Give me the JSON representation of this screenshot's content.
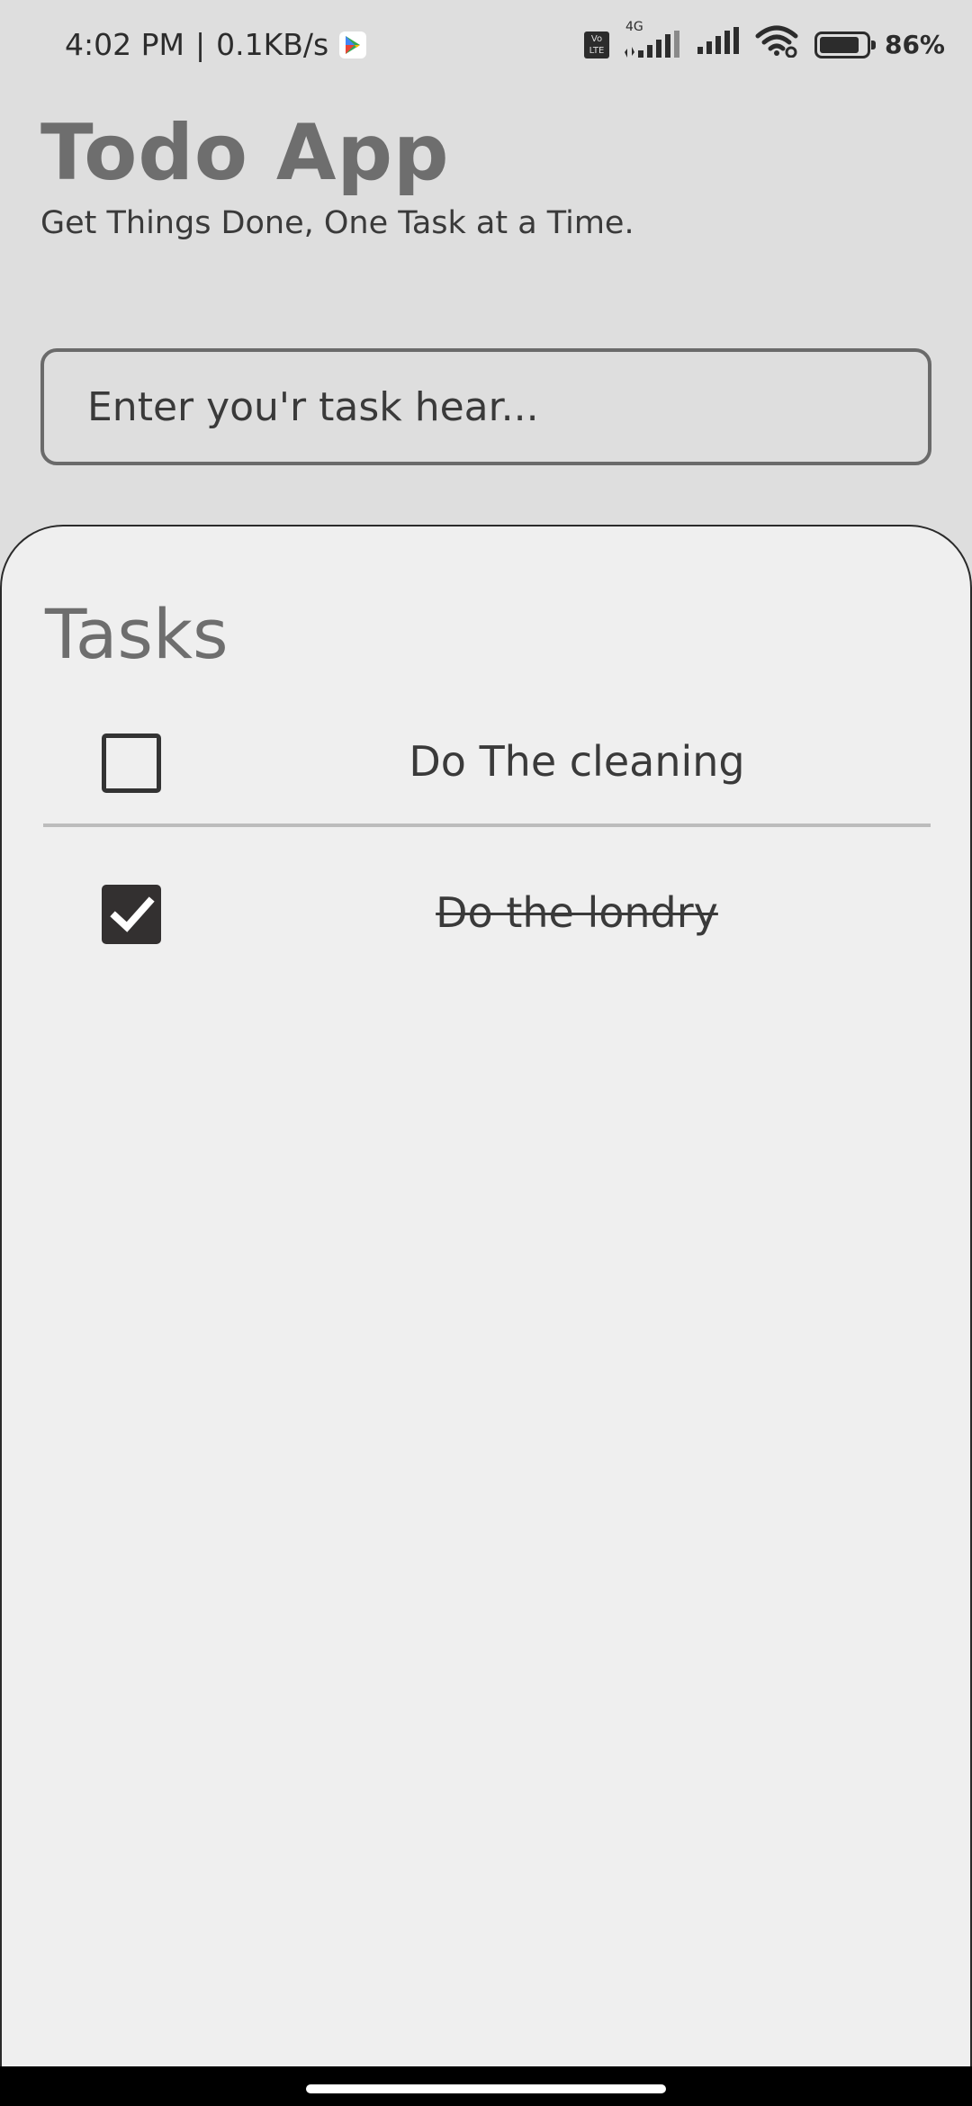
{
  "status_bar": {
    "time": "4:02 PM",
    "separator": "|",
    "network_speed": "0.1KB/s",
    "volte_label": "Vo LTE",
    "network_type": "4G",
    "battery_percent": "86%",
    "battery_level": 0.86,
    "icons": [
      "play-store-icon",
      "volte-icon",
      "signal-icon",
      "wifi-icon",
      "battery-icon"
    ]
  },
  "header": {
    "title": "Todo App",
    "subtitle": "Get Things Done, One Task at a Time."
  },
  "input": {
    "placeholder": "Enter you'r task hear...",
    "value": ""
  },
  "tasks": {
    "heading": "Tasks",
    "items": [
      {
        "label": "Do The cleaning",
        "completed": false
      },
      {
        "label": "Do the londry",
        "completed": true
      }
    ]
  },
  "colors": {
    "background": "#dedede",
    "panel": "#efefef",
    "title": "#6e6e6e",
    "text": "#3a3a3a",
    "checkbox_checked": "#333030"
  }
}
